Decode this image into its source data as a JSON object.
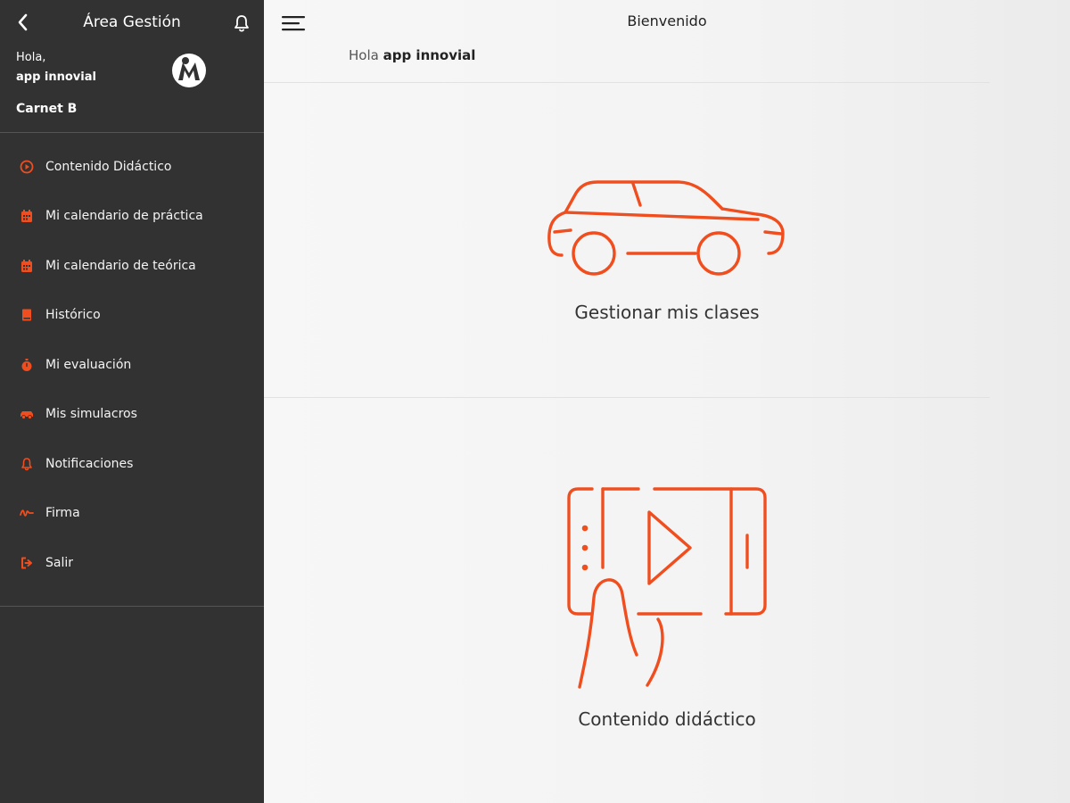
{
  "colors": {
    "accent": "#f04e1e",
    "sidebar_bg": "#323232",
    "main_bg": "#f4f4f4"
  },
  "sidebar": {
    "title": "Área Gestión",
    "greeting": "Hola,",
    "user_name": "app innovial",
    "license": "Carnet B",
    "items": [
      {
        "label": "Contenido Didáctico",
        "icon": "play-circle-icon"
      },
      {
        "label": "Mi calendario de práctica",
        "icon": "calendar-icon"
      },
      {
        "label": "Mi calendario de teórica",
        "icon": "calendar-icon"
      },
      {
        "label": "Histórico",
        "icon": "book-icon"
      },
      {
        "label": "Mi evaluación",
        "icon": "stopwatch-icon"
      },
      {
        "label": "Mis simulacros",
        "icon": "car-icon"
      },
      {
        "label": "Notificaciones",
        "icon": "bell-icon"
      },
      {
        "label": "Firma",
        "icon": "signature-icon"
      },
      {
        "label": "Salir",
        "icon": "logout-icon"
      }
    ]
  },
  "header": {
    "title": "Bienvenido",
    "greeting_prefix": "Hola",
    "greeting_name": "app innovial"
  },
  "cards": [
    {
      "label": "Gestionar mis clases",
      "icon": "car-outline-icon"
    },
    {
      "label": "Contenido didáctico",
      "icon": "tablet-video-icon"
    }
  ]
}
